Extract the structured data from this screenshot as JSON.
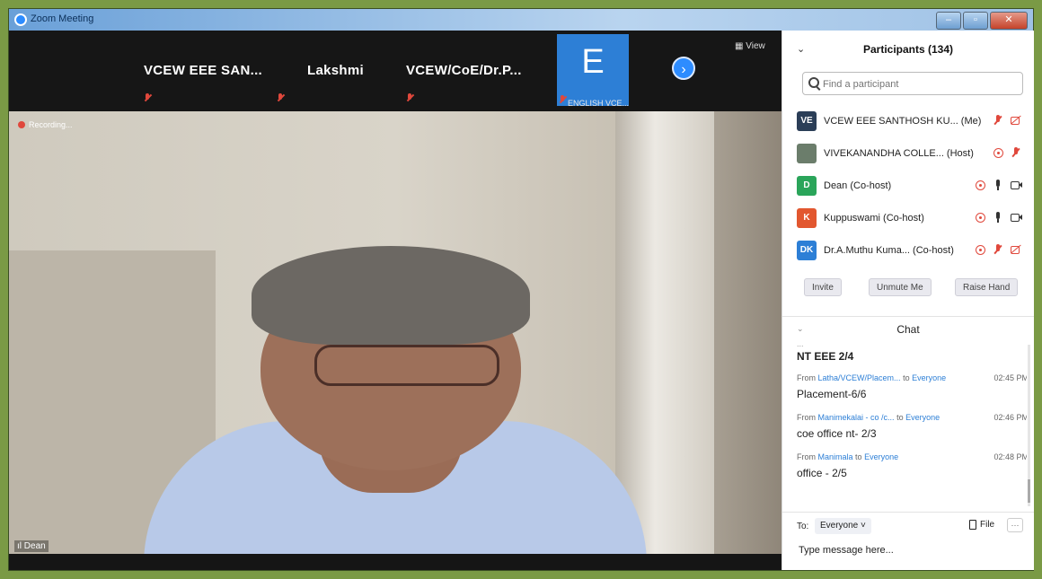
{
  "window": {
    "title": "Zoom Meeting",
    "minimize": "–",
    "maximize": "▫",
    "close": "✕"
  },
  "gallery": {
    "tiles": [
      {
        "name": "VCEW EEE  SAN..."
      },
      {
        "name": "Lakshmi"
      },
      {
        "name": "VCEW/CoE/Dr.P..."
      }
    ],
    "avatar_tile": {
      "letter": "E",
      "label": "ENGLISH VCE..."
    },
    "next": "›",
    "view": "View"
  },
  "video": {
    "recording": "Recording...",
    "speaker": "Dean"
  },
  "participants": {
    "title": "Participants (134)",
    "search_placeholder": "Find a participant",
    "list": [
      {
        "initials": "VE",
        "name": "VCEW EEE  SANTHOSH KU... (Me)",
        "color": "#2b3e57"
      },
      {
        "initials": "",
        "name": "VIVEKANANDHA COLLE...  (Host)",
        "color": "#6b7d6b"
      },
      {
        "initials": "D",
        "name": "Dean (Co-host)",
        "color": "#2aa55a"
      },
      {
        "initials": "K",
        "name": "Kuppuswami (Co-host)",
        "color": "#e2572f"
      },
      {
        "initials": "DK",
        "name": "Dr.A.Muthu Kuma...  (Co-host)",
        "color": "#2d7fd6"
      }
    ],
    "buttons": {
      "invite": "Invite",
      "unmute": "Unmute Me",
      "raise_hand": "Raise Hand"
    }
  },
  "chat": {
    "title": "Chat",
    "partial_line": "...",
    "prev_text": "NT EEE 2/4",
    "messages": [
      {
        "from_word": "From",
        "from": "Latha/VCEW/Placem...",
        "to_word": "to",
        "to": "Everyone",
        "time": "02:45 PM",
        "text": "Placement-6/6"
      },
      {
        "from_word": "From",
        "from": "Manimekalai - co /c...",
        "to_word": "to",
        "to": "Everyone",
        "time": "02:46 PM",
        "text": "coe office nt- 2/3"
      },
      {
        "from_word": "From",
        "from": "Manimala",
        "to_word": "to",
        "to": "Everyone",
        "time": "02:48 PM",
        "text": "office - 2/5"
      }
    ],
    "to_label": "To:",
    "to_value": "Everyone ˅",
    "file_label": "File",
    "more": "···",
    "input_placeholder": "Type message here..."
  }
}
